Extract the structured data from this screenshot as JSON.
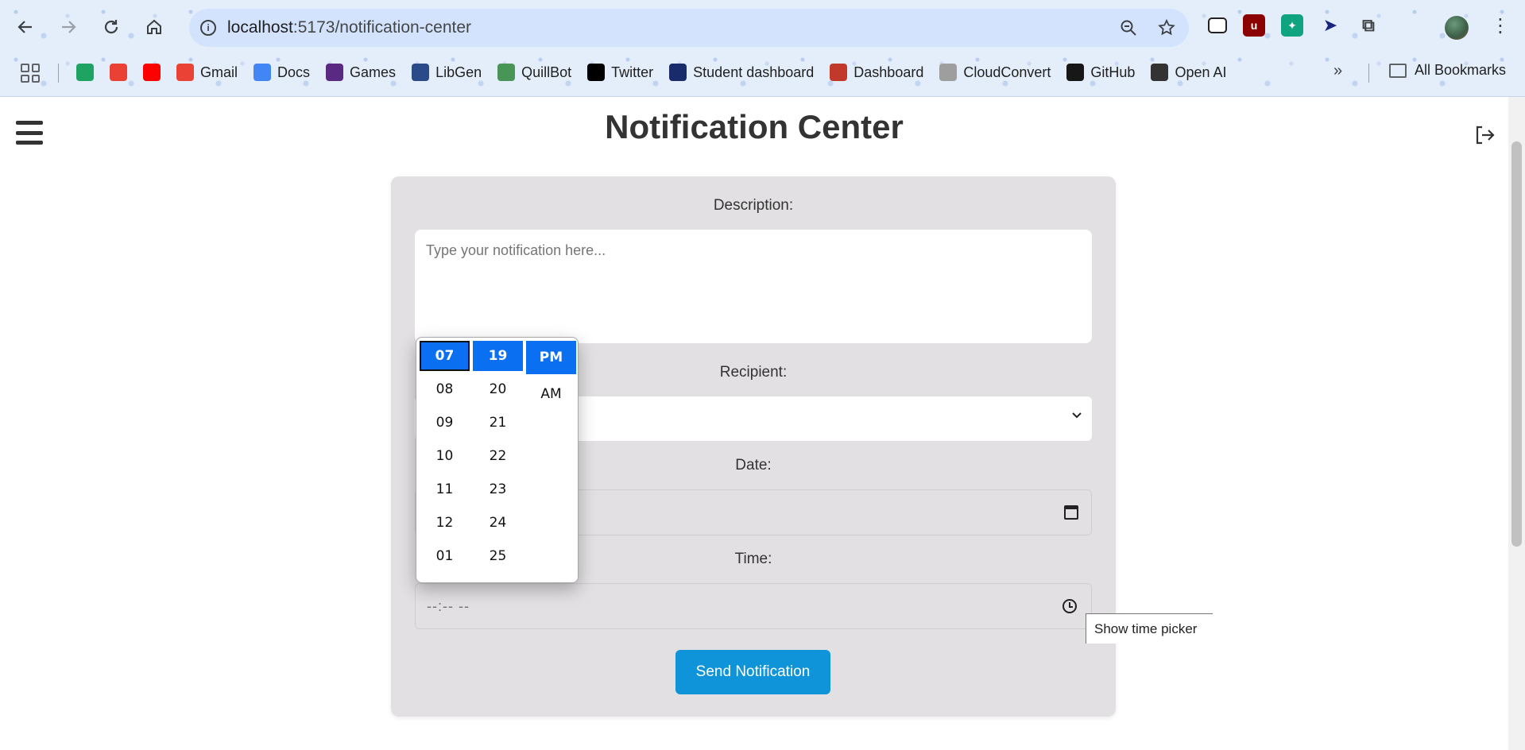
{
  "browser": {
    "url_host": "localhost",
    "url_path": ":5173/notification-center",
    "bookmarks": [
      {
        "label": "",
        "icon": "google-drive-icon",
        "color": "#1ea362"
      },
      {
        "label": "",
        "icon": "rainbow-icon",
        "color": "#e94235"
      },
      {
        "label": "",
        "icon": "youtube-icon",
        "color": "#ff0000"
      },
      {
        "label": "Gmail",
        "icon": "gmail-icon",
        "color": "#ea4335"
      },
      {
        "label": "Docs",
        "icon": "docs-icon",
        "color": "#4285f4"
      },
      {
        "label": "Games",
        "icon": "games-icon",
        "color": "#5a2a82"
      },
      {
        "label": "LibGen",
        "icon": "libgen-icon",
        "color": "#2b4a8a"
      },
      {
        "label": "QuillBot",
        "icon": "quillbot-icon",
        "color": "#499557"
      },
      {
        "label": "Twitter",
        "icon": "x-icon",
        "color": "#000000"
      },
      {
        "label": "Student dashboard",
        "icon": "student-dashboard-icon",
        "color": "#1a2b6b"
      },
      {
        "label": "Dashboard",
        "icon": "dashboard-icon",
        "color": "#c0392b"
      },
      {
        "label": "CloudConvert",
        "icon": "cloudconvert-icon",
        "color": "#9e9e9e"
      },
      {
        "label": "GitHub",
        "icon": "github-icon",
        "color": "#181717"
      },
      {
        "label": "Open AI",
        "icon": "openai-icon",
        "color": "#333333"
      }
    ],
    "all_bookmarks_label": "All Bookmarks"
  },
  "page": {
    "title": "Notification Center",
    "form": {
      "description_label": "Description:",
      "description_placeholder": "Type your notification here...",
      "recipient_label": "Recipient:",
      "date_label": "Date:",
      "time_label": "Time:",
      "time_value": "--:-- --",
      "send_label": "Send Notification"
    },
    "tooltip": "Show time picker"
  },
  "time_picker": {
    "hours": [
      "07",
      "08",
      "09",
      "10",
      "11",
      "12",
      "01"
    ],
    "minutes": [
      "19",
      "20",
      "21",
      "22",
      "23",
      "24",
      "25"
    ],
    "meridiem": [
      "PM",
      "AM"
    ],
    "selected_hour": "07",
    "selected_minute": "19",
    "selected_meridiem": "PM"
  },
  "colors": {
    "accent": "#0f94d9",
    "picker_selected": "#0a6ff0",
    "card_bg": "#e2e0e2"
  }
}
